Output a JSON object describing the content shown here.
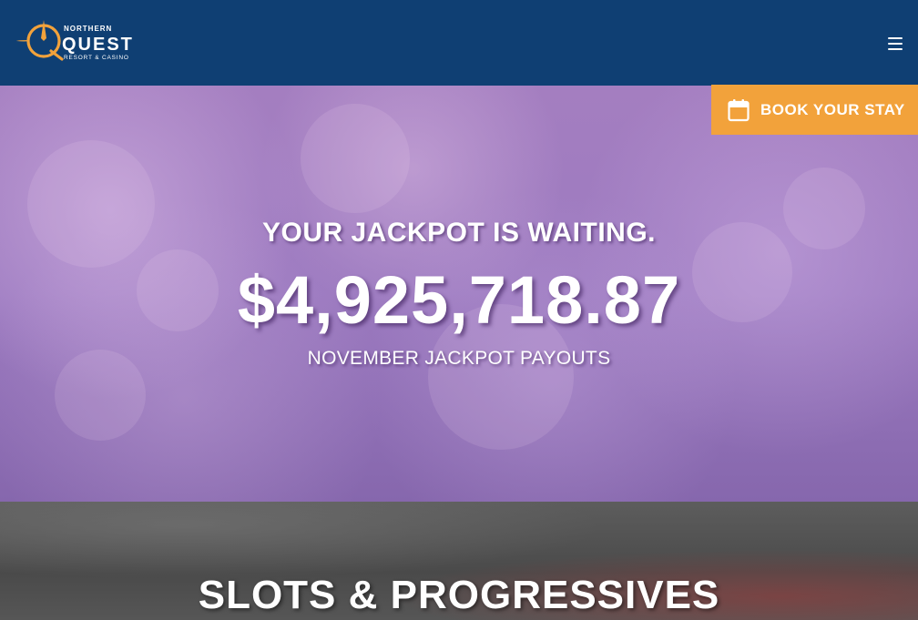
{
  "header": {
    "logo": {
      "top_text": "NORTHERN",
      "main_text": "QUEST",
      "bottom_text": "RESORT & CASINO"
    },
    "menu_icon": "hamburger-menu-icon"
  },
  "book_button": {
    "label": "BOOK YOUR STAY",
    "icon": "calendar-icon"
  },
  "hero": {
    "tagline": "YOUR JACKPOT IS WAITING.",
    "amount": "$4,925,718.87",
    "subline": "NOVEMBER JACKPOT PAYOUTS"
  },
  "section": {
    "title": "SLOTS & PROGRESSIVES"
  },
  "colors": {
    "header_bg": "#0f3f73",
    "accent": "#f2a23b",
    "hero_purple": "#9c7ac0"
  }
}
